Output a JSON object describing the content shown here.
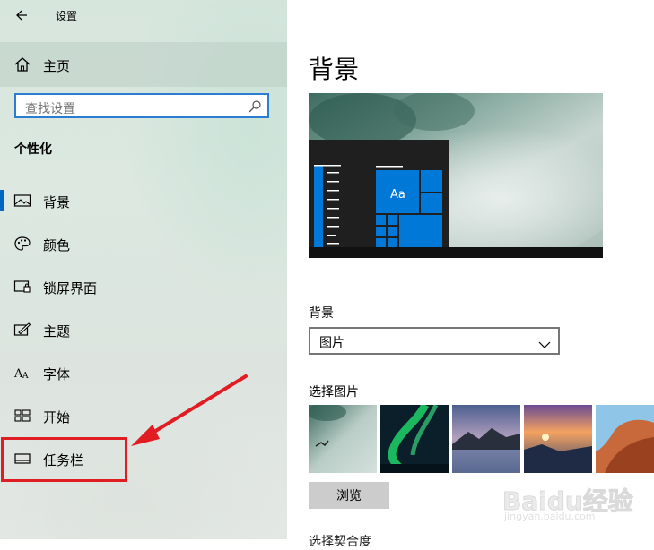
{
  "window": {
    "title": "设置"
  },
  "sidebar": {
    "home_label": "主页",
    "search_placeholder": "查找设置",
    "section_heading": "个性化",
    "items": [
      {
        "label": "背景",
        "icon": "picture-icon",
        "selected": true
      },
      {
        "label": "颜色",
        "icon": "palette-icon"
      },
      {
        "label": "锁屏界面",
        "icon": "lock-screen-icon"
      },
      {
        "label": "主题",
        "icon": "theme-brush-icon"
      },
      {
        "label": "字体",
        "icon": "font-icon"
      },
      {
        "label": "开始",
        "icon": "start-tiles-icon"
      },
      {
        "label": "任务栏",
        "icon": "taskbar-icon"
      }
    ]
  },
  "main": {
    "title": "背景",
    "preview": {
      "tile_text": "Aa"
    },
    "background_label": "背景",
    "background_value": "图片",
    "choose_picture_label": "选择图片",
    "browse_button": "浏览",
    "next_section_partial": "选择契合度"
  },
  "annotations": {
    "highlight_color": "#e11d24"
  },
  "watermark": {
    "logo": "Baidu经验",
    "url": "jingyan.baidu.com"
  },
  "colors": {
    "accent": "#0067c0",
    "tile_blue": "#0078d7"
  }
}
